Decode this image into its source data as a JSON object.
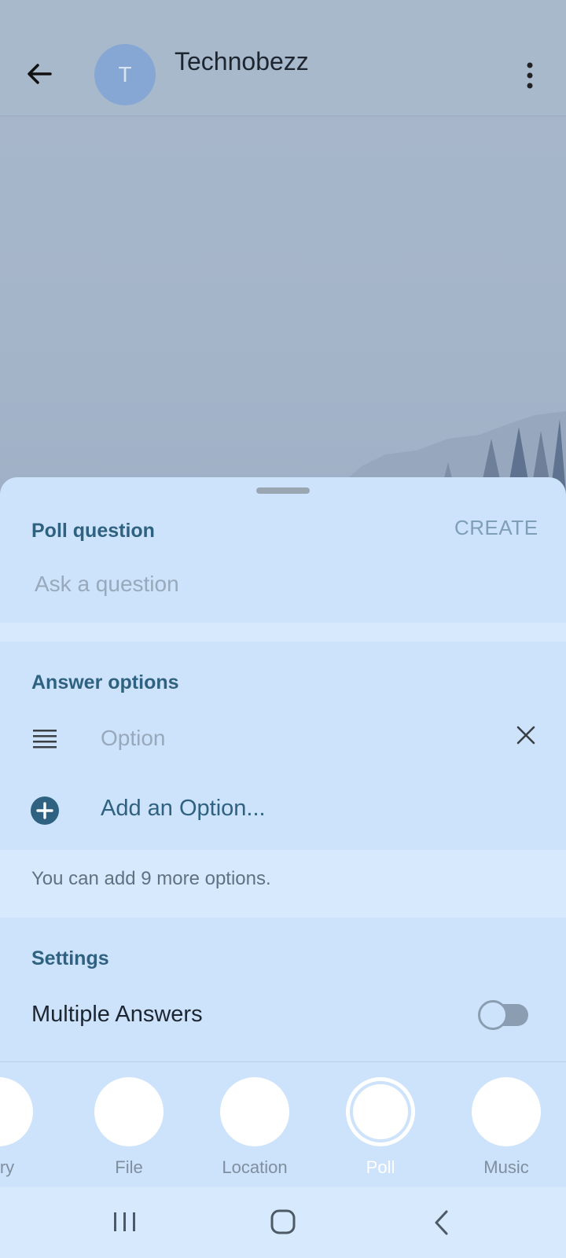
{
  "header": {
    "avatar_letter": "T",
    "title": "Technobezz"
  },
  "poll": {
    "question_section": "Poll question",
    "create_label": "CREATE",
    "question_placeholder": "Ask a question",
    "answers_section": "Answer options",
    "option_placeholder": "Option",
    "add_option_label": "Add an Option...",
    "remaining_info": "You can add 9 more options.",
    "settings_section": "Settings",
    "multiple_answers_label": "Multiple Answers",
    "multiple_answers_enabled": false
  },
  "attachments": [
    {
      "label": "llery",
      "icon": "gallery-icon",
      "selected": false
    },
    {
      "label": "File",
      "icon": "file-icon",
      "selected": false
    },
    {
      "label": "Location",
      "icon": "location-icon",
      "selected": false
    },
    {
      "label": "Poll",
      "icon": "poll-icon",
      "selected": true
    },
    {
      "label": "Music",
      "icon": "music-icon",
      "selected": false
    }
  ],
  "colors": {
    "accent": "#2f6280",
    "sheet": "#cde2fb",
    "header": "#a8b9cc"
  }
}
